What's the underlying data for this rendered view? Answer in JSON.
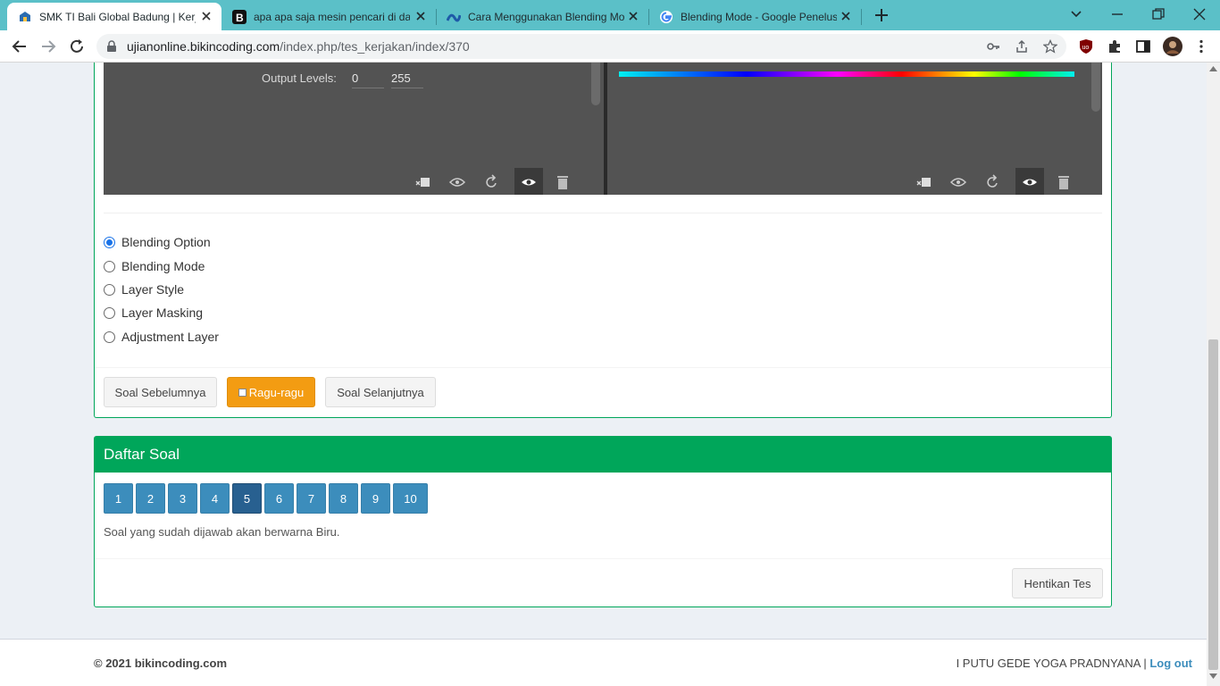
{
  "browser": {
    "tabs": [
      {
        "title": "SMK TI Bali Global Badung | Kerja",
        "active": true
      },
      {
        "title": "apa apa saja mesin pencari di dal",
        "active": false
      },
      {
        "title": "Cara Menggunakan Blending Mo",
        "active": false
      },
      {
        "title": "Blending Mode - Google Penelus",
        "active": false
      }
    ],
    "url_host": "ujianonline.bikincoding.com",
    "url_path": "/index.php/tes_kerjakan/index/370"
  },
  "question": {
    "image": {
      "output_levels_label": "Output Levels:",
      "output_low": "0",
      "output_high": "255"
    },
    "options": [
      {
        "label": "Blending Option",
        "checked": true
      },
      {
        "label": "Blending Mode",
        "checked": false
      },
      {
        "label": "Layer Style",
        "checked": false
      },
      {
        "label": "Layer Masking",
        "checked": false
      },
      {
        "label": "Adjustment Layer",
        "checked": false
      }
    ],
    "buttons": {
      "prev": "Soal Sebelumnya",
      "doubt": "Ragu-ragu",
      "next": "Soal Selanjutnya"
    }
  },
  "daftar": {
    "title": "Daftar Soal",
    "numbers": [
      "1",
      "2",
      "3",
      "4",
      "5",
      "6",
      "7",
      "8",
      "9",
      "10"
    ],
    "current": "5",
    "note": "Soal yang sudah dijawab akan berwarna Biru.",
    "stop_label": "Hentikan Tes"
  },
  "footer": {
    "copyright": "© 2021 bikincoding.com",
    "user": "I PUTU GEDE YOGA PRADNYANA",
    "separator": "|",
    "logout": "Log out"
  },
  "colors": {
    "success": "#00a65a",
    "primary": "#3c8dbc",
    "warning": "#f39c12",
    "chrome": "#5bc0c8"
  }
}
